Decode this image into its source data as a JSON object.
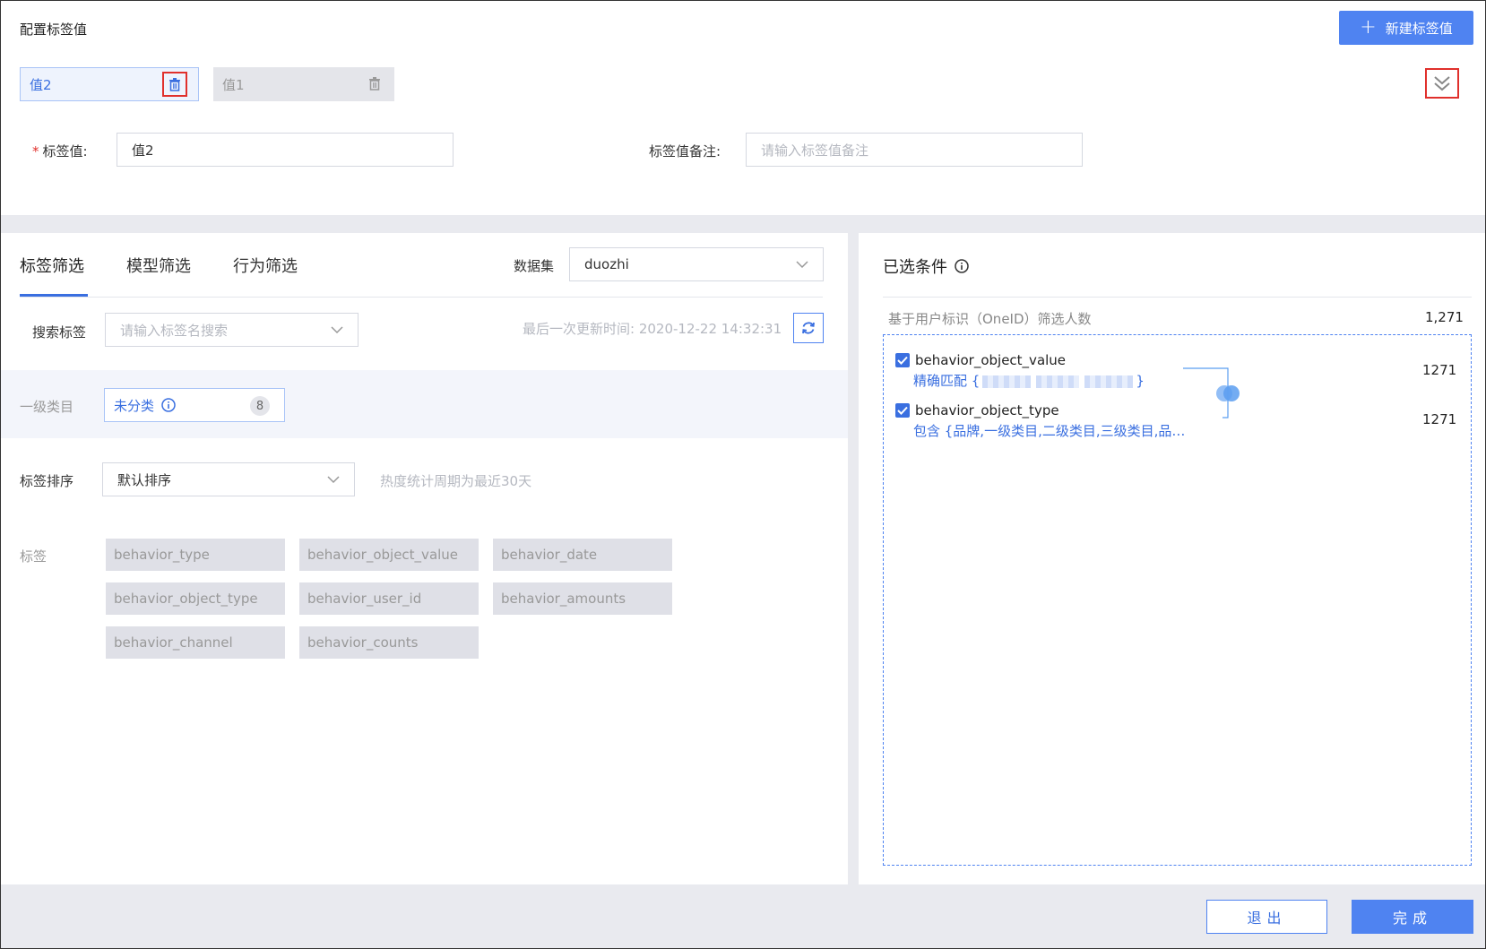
{
  "header": {
    "title": "配置标签值",
    "new_button_label": "新建标签值"
  },
  "value_tabs": [
    {
      "label": "值2",
      "active": true
    },
    {
      "label": "值1",
      "active": false
    }
  ],
  "form": {
    "tag_value_label": "标签值:",
    "tag_value": "值2",
    "note_label": "标签值备注:",
    "note_placeholder": "请输入标签值备注"
  },
  "filter_tabs": [
    "标签筛选",
    "模型筛选",
    "行为筛选"
  ],
  "dataset": {
    "label": "数据集",
    "value": "duozhi"
  },
  "search": {
    "label": "搜索标签",
    "placeholder": "请输入标签名搜索",
    "last_update": "最后一次更新时间: 2020-12-22 14:32:31"
  },
  "category": {
    "label": "一级类目",
    "chip_label": "未分类",
    "chip_count": "8"
  },
  "sort": {
    "label": "标签排序",
    "value": "默认排序",
    "hint": "热度统计周期为最近30天"
  },
  "tags": {
    "label": "标签",
    "items": [
      "behavior_type",
      "behavior_object_value",
      "behavior_date",
      "behavior_object_type",
      "behavior_user_id",
      "behavior_amounts",
      "behavior_channel",
      "behavior_counts"
    ]
  },
  "selected": {
    "title": "已选条件",
    "basis_label": "基于用户标识（OneID）筛选人数",
    "basis_count": "1,271",
    "conditions": [
      {
        "name": "behavior_object_value",
        "detail_prefix": "精确匹配 {",
        "detail_suffix": "}",
        "count": "1271"
      },
      {
        "name": "behavior_object_type",
        "detail": "包含 {品牌,一级类目,二级类目,三级类目,品…",
        "count": "1271"
      }
    ]
  },
  "footer": {
    "exit_label": "退出",
    "done_label": "完成"
  },
  "colors": {
    "primary": "#4f83f1",
    "danger": "#e0302c",
    "chip_bg": "#dfe0e7"
  }
}
